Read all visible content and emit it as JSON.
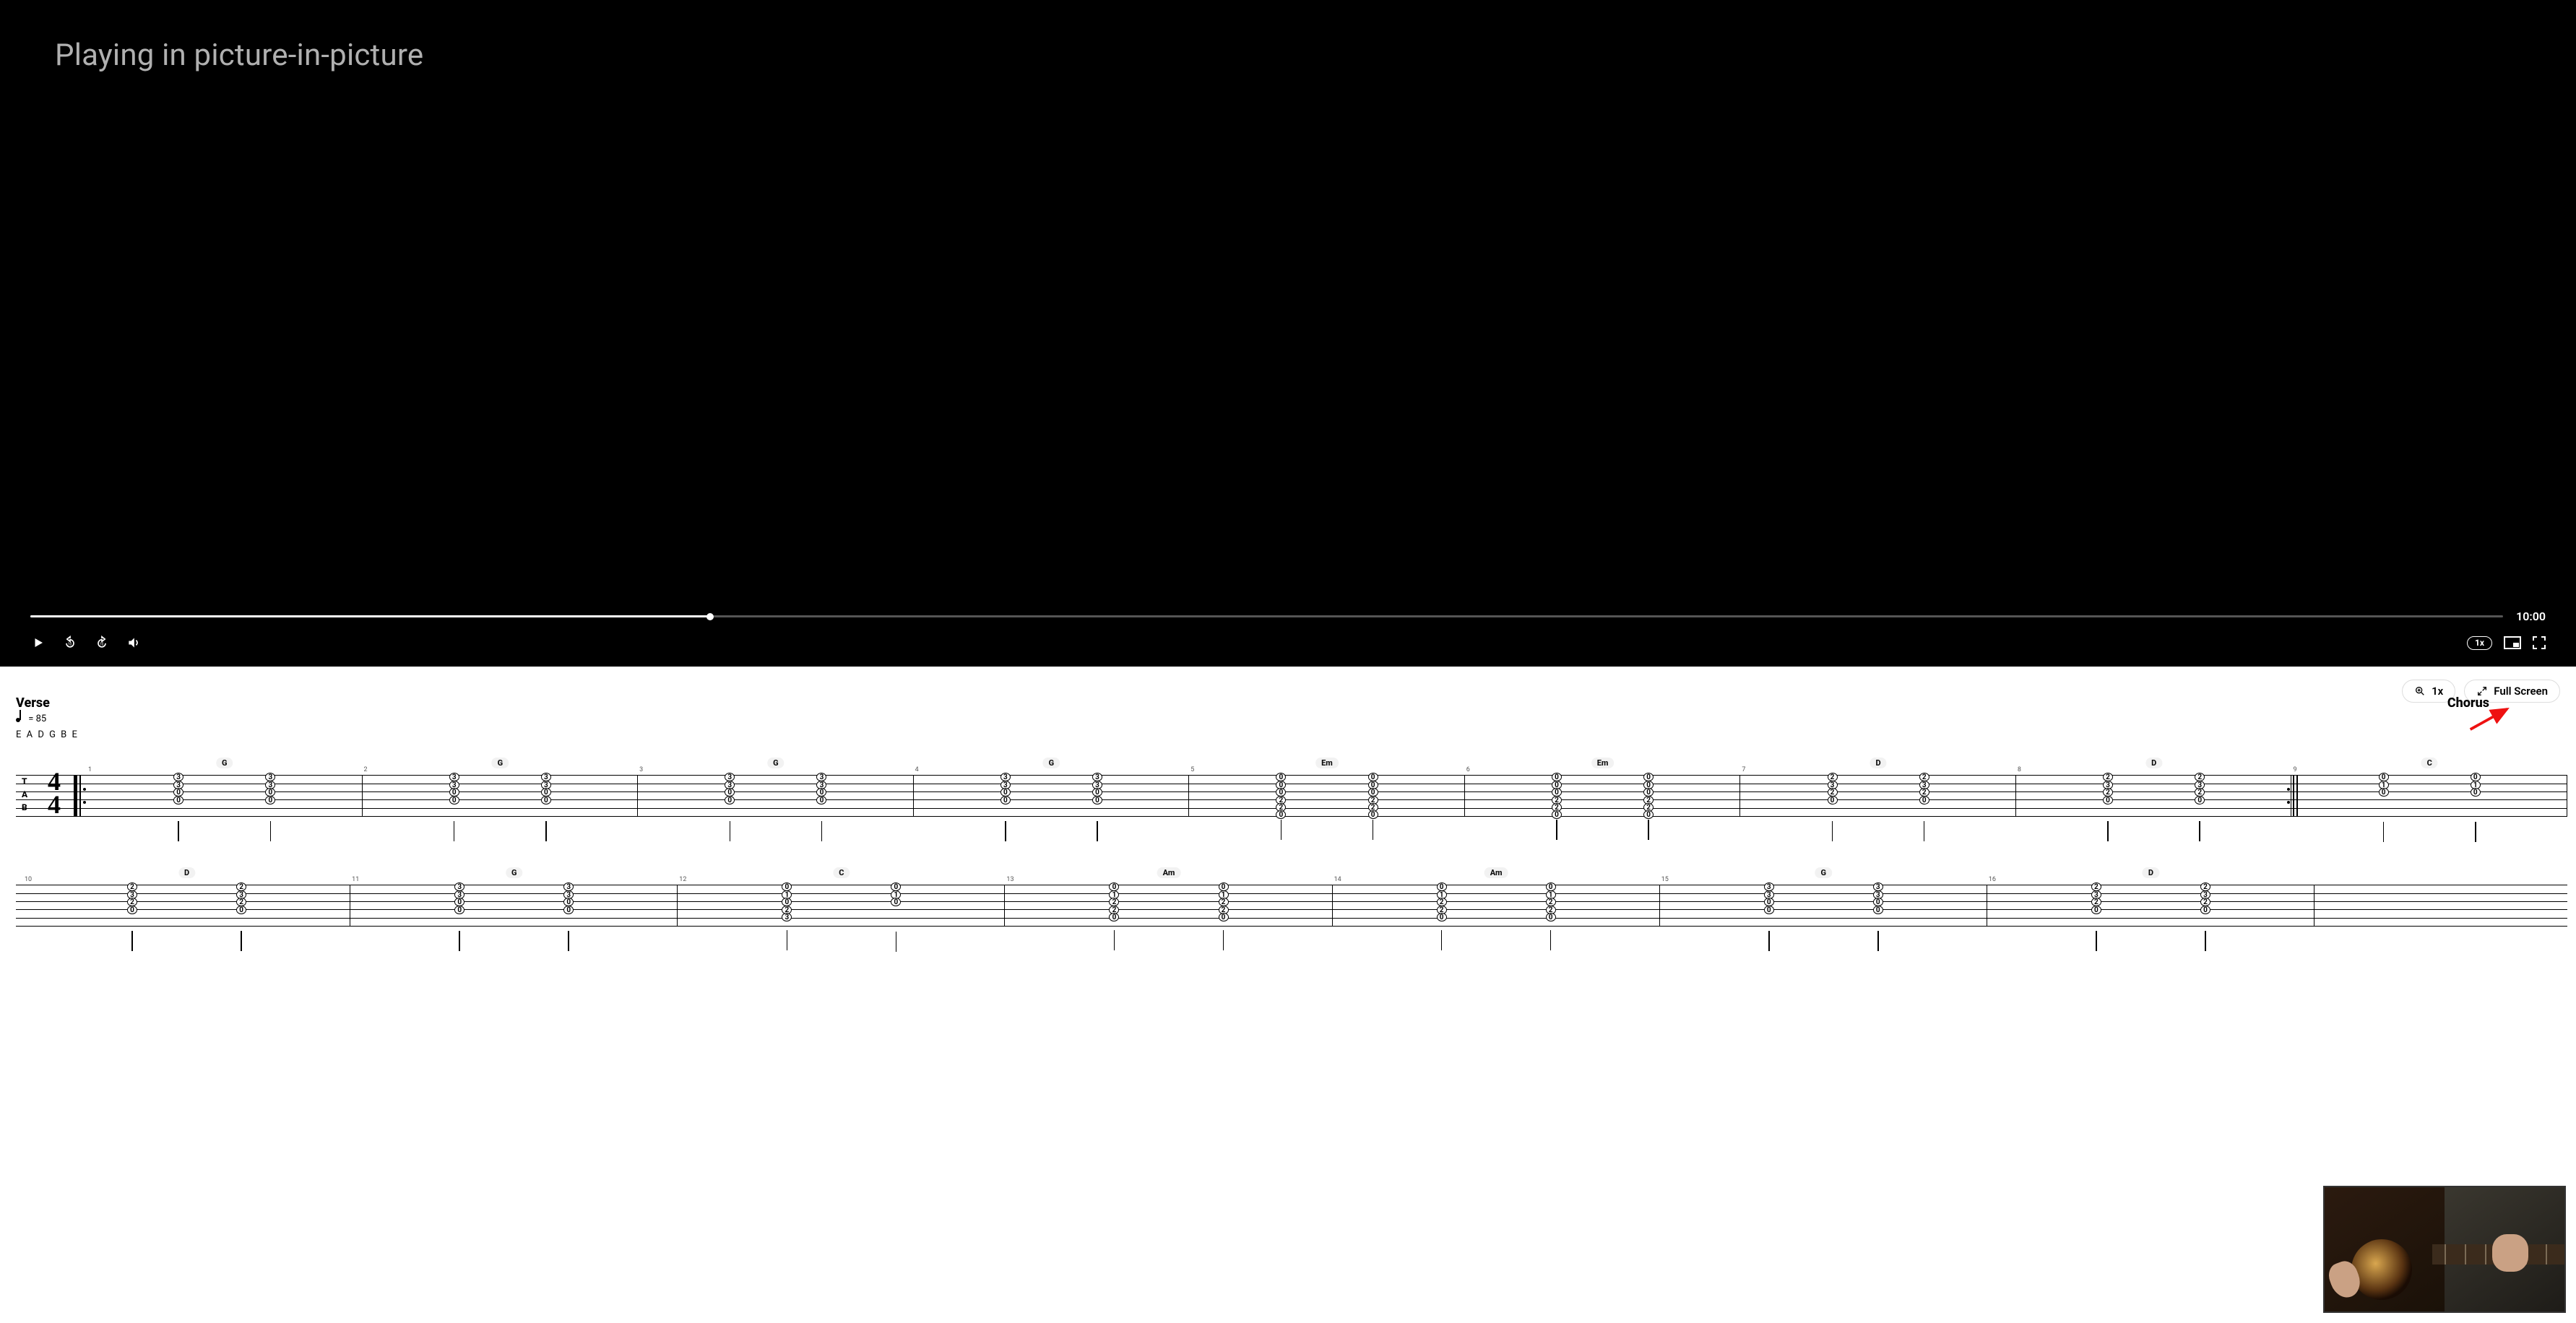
{
  "video": {
    "overlay_text": "Playing in picture-in-picture",
    "total_time": "10:00",
    "progress_percent": 27.5,
    "speed_label": "1x"
  },
  "toolbar": {
    "zoom_label": "1x",
    "full_screen_label": "Full Screen"
  },
  "sections": {
    "verse_label": "Verse",
    "chorus_label": "Chorus"
  },
  "meta": {
    "tempo_prefix": "= 85",
    "tempo_bpm": 85,
    "tuning": "E A D G B E",
    "tab_letters": [
      "T",
      "A",
      "B"
    ],
    "time_sig_top": "4",
    "time_sig_bottom": "4"
  },
  "tab": {
    "rows": [
      {
        "bars": [
          {
            "num": 1,
            "chord": "G",
            "cols": [
              [
                "3",
                "3",
                "0",
                "0",
                "",
                ""
              ],
              [
                "3",
                "3",
                "0",
                "0",
                "",
                ""
              ]
            ]
          },
          {
            "num": 2,
            "chord": "G",
            "cols": [
              [
                "3",
                "3",
                "0",
                "0",
                "",
                ""
              ],
              [
                "3",
                "3",
                "0",
                "0",
                "",
                ""
              ]
            ]
          },
          {
            "num": 3,
            "chord": "G",
            "cols": [
              [
                "3",
                "3",
                "0",
                "0",
                "",
                ""
              ],
              [
                "3",
                "3",
                "0",
                "0",
                "",
                ""
              ]
            ]
          },
          {
            "num": 4,
            "chord": "G",
            "cols": [
              [
                "3",
                "3",
                "0",
                "0",
                "",
                ""
              ],
              [
                "3",
                "3",
                "0",
                "0",
                "",
                ""
              ]
            ]
          },
          {
            "num": 5,
            "chord": "Em",
            "cols": [
              [
                "0",
                "0",
                "0",
                "2",
                "2",
                "0"
              ],
              [
                "0",
                "0",
                "0",
                "2",
                "2",
                "0"
              ]
            ]
          },
          {
            "num": 6,
            "chord": "Em",
            "cols": [
              [
                "0",
                "0",
                "0",
                "2",
                "2",
                "0"
              ],
              [
                "0",
                "0",
                "0",
                "2",
                "2",
                "0"
              ]
            ]
          },
          {
            "num": 7,
            "chord": "D",
            "cols": [
              [
                "2",
                "3",
                "2",
                "0",
                "",
                ""
              ],
              [
                "2",
                "3",
                "2",
                "0",
                "",
                ""
              ]
            ]
          },
          {
            "num": 8,
            "chord": "D",
            "cols": [
              [
                "2",
                "3",
                "2",
                "0",
                "",
                ""
              ],
              [
                "2",
                "3",
                "2",
                "0",
                "",
                ""
              ]
            ],
            "end_repeat": true
          },
          {
            "num": 9,
            "chord": "C",
            "cols": [
              [
                "0",
                "1",
                "0",
                "",
                "",
                ""
              ],
              [
                "0",
                "1",
                "0",
                "",
                "",
                ""
              ]
            ]
          }
        ]
      },
      {
        "bars": [
          {
            "num": 10,
            "chord": "D",
            "cols": [
              [
                "2",
                "3",
                "2",
                "0",
                "",
                ""
              ],
              [
                "2",
                "3",
                "2",
                "0",
                "",
                ""
              ]
            ]
          },
          {
            "num": 11,
            "chord": "G",
            "cols": [
              [
                "3",
                "3",
                "0",
                "0",
                "",
                ""
              ],
              [
                "3",
                "3",
                "0",
                "0",
                "",
                ""
              ]
            ]
          },
          {
            "num": 12,
            "chord": "C",
            "cols": [
              [
                "0",
                "1",
                "0",
                "2",
                "3",
                ""
              ],
              [
                "0",
                "1",
                "0",
                "",
                "",
                ""
              ]
            ]
          },
          {
            "num": 13,
            "chord": "Am",
            "cols": [
              [
                "0",
                "1",
                "2",
                "2",
                "0",
                ""
              ],
              [
                "0",
                "1",
                "2",
                "2",
                "0",
                ""
              ]
            ]
          },
          {
            "num": 14,
            "chord": "Am",
            "cols": [
              [
                "0",
                "1",
                "2",
                "2",
                "0",
                ""
              ],
              [
                "0",
                "1",
                "2",
                "2",
                "0",
                ""
              ]
            ]
          },
          {
            "num": 15,
            "chord": "G",
            "cols": [
              [
                "3",
                "3",
                "0",
                "0",
                "",
                ""
              ],
              [
                "3",
                "3",
                "0",
                "0",
                "",
                ""
              ]
            ]
          },
          {
            "num": 16,
            "chord": "D",
            "cols": [
              [
                "2",
                "3",
                "2",
                "0",
                "",
                ""
              ],
              [
                "2",
                "3",
                "2",
                "0",
                "",
                ""
              ]
            ]
          }
        ]
      }
    ]
  }
}
